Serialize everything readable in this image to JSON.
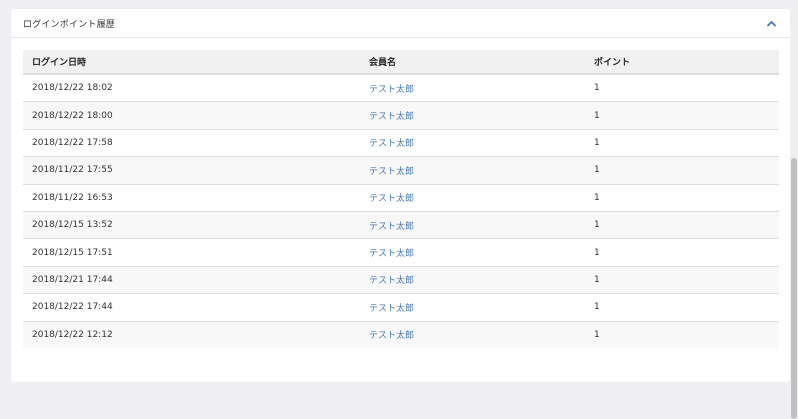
{
  "card": {
    "title": "ログインポイント履歴"
  },
  "icons": {
    "collapse": "chevron-up-icon",
    "accent": "#3f78c2"
  },
  "table": {
    "columns": [
      "ログイン日時",
      "会員名",
      "ポイント"
    ],
    "rows": [
      {
        "datetime": "2018/12/22 18:02",
        "member": "テスト太郎",
        "points": "1"
      },
      {
        "datetime": "2018/12/22 18:00",
        "member": "テスト太郎",
        "points": "1"
      },
      {
        "datetime": "2018/12/22 17:58",
        "member": "テスト太郎",
        "points": "1"
      },
      {
        "datetime": "2018/11/22 17:55",
        "member": "テスト太郎",
        "points": "1"
      },
      {
        "datetime": "2018/11/22 16:53",
        "member": "テスト太郎",
        "points": "1"
      },
      {
        "datetime": "2018/12/15 13:52",
        "member": "テスト太郎",
        "points": "1"
      },
      {
        "datetime": "2018/12/15 17:51",
        "member": "テスト太郎",
        "points": "1"
      },
      {
        "datetime": "2018/12/21 17:44",
        "member": "テスト太郎",
        "points": "1"
      },
      {
        "datetime": "2018/12/22 17:44",
        "member": "テスト太郎",
        "points": "1"
      },
      {
        "datetime": "2018/12/22 12:12",
        "member": "テスト太郎",
        "points": "1"
      }
    ]
  }
}
